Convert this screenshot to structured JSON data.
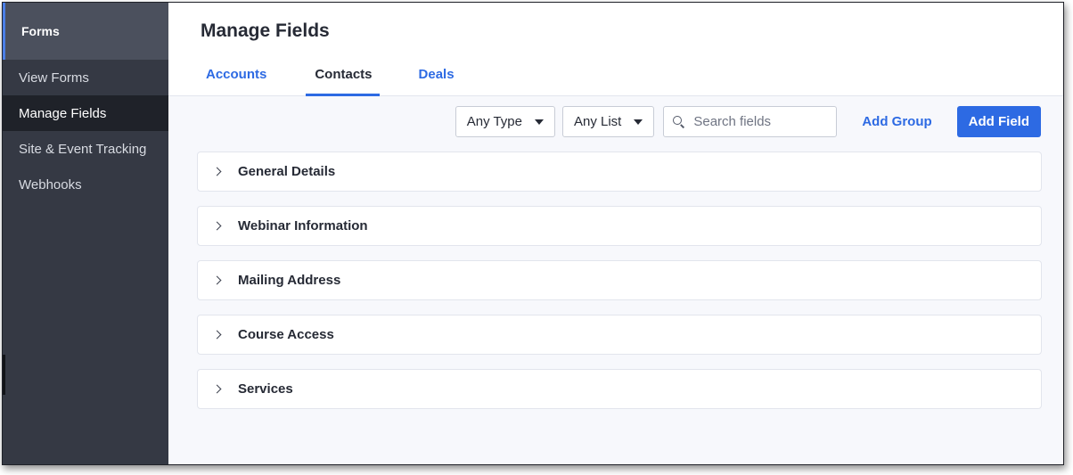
{
  "sidebar": {
    "header": "Forms",
    "items": [
      {
        "label": "View Forms"
      },
      {
        "label": "Manage Fields",
        "active": true
      },
      {
        "label": "Site & Event Tracking"
      },
      {
        "label": "Webhooks"
      }
    ]
  },
  "header": {
    "title": "Manage Fields",
    "tabs": [
      {
        "label": "Accounts"
      },
      {
        "label": "Contacts",
        "active": true
      },
      {
        "label": "Deals"
      }
    ]
  },
  "toolbar": {
    "type_filter": "Any Type",
    "list_filter": "Any List",
    "search_placeholder": "Search fields",
    "add_group": "Add Group",
    "add_field": "Add Field"
  },
  "groups": [
    {
      "label": "General Details"
    },
    {
      "label": "Webinar Information"
    },
    {
      "label": "Mailing Address"
    },
    {
      "label": "Course Access"
    },
    {
      "label": "Services"
    }
  ],
  "colors": {
    "accent": "#2d6ae3",
    "sidebar_bg": "#353944",
    "sidebar_active": "#1f2229"
  }
}
